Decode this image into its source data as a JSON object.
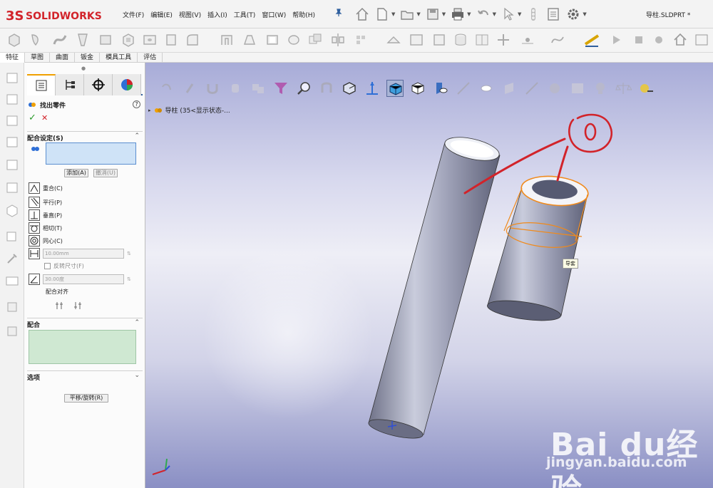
{
  "app": {
    "logo_text": "SOLIDWORKS",
    "file_title": "导柱.SLDPRT *"
  },
  "menu": [
    "文件(F)",
    "编辑(E)",
    "视图(V)",
    "插入(I)",
    "工具(T)",
    "窗口(W)",
    "帮助(H)"
  ],
  "tabs": [
    "特征",
    "草图",
    "曲面",
    "钣金",
    "模具工具",
    "评估"
  ],
  "active_tab": "特征",
  "panel": {
    "title": "找出零件",
    "mate_settings_label": "配合设定(S)",
    "add_button": "添加(A)",
    "undo_button": "撤消(U)",
    "mate_types": [
      {
        "label": "重合(C)",
        "icon": "coincident-icon"
      },
      {
        "label": "平行(P)",
        "icon": "parallel-icon"
      },
      {
        "label": "垂直(P)",
        "icon": "perpendicular-icon"
      },
      {
        "label": "相切(T)",
        "icon": "tangent-icon"
      },
      {
        "label": "同心(C)",
        "icon": "concentric-icon"
      }
    ],
    "distance_value": "10.00mm",
    "flip_label": "反转尺寸(F)",
    "angle_value": "30.00度",
    "align_label": "配合对齐",
    "mates_label": "配合",
    "options_label": "选项",
    "move_button": "平移/旋转(R)"
  },
  "viewport": {
    "tree_label": "导柱  (35<显示状态-...",
    "callout": "导套",
    "annotation": "①"
  },
  "watermark": {
    "brand": "Bai du经验",
    "url": "jingyan.baidu.com"
  },
  "colors": {
    "accent_red": "#d2232a",
    "selection_orange": "#f08a1c",
    "viewport_top": "#a8acd8",
    "viewport_bottom": "#8a8fc4",
    "mate_selection_fill": "#cfe3f7",
    "mates_fill": "#cfe8d2"
  }
}
